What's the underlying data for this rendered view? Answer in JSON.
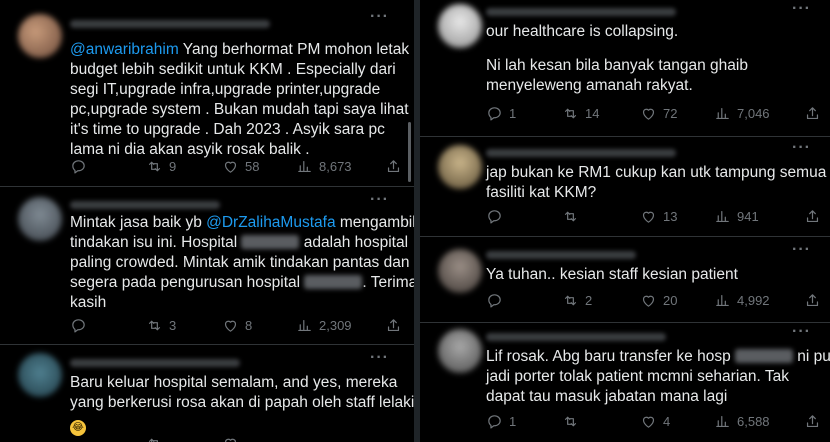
{
  "left": {
    "tweets": [
      {
        "lines": [
          {
            "mention": "@anwaribrahim",
            "rest": " Yang berhormat PM mohon letak"
          },
          {
            "text": "budget lebih sedikit untuk KKM . Especially dari"
          },
          {
            "text": "segi IT,upgrade infra,upgrade printer,upgrade"
          },
          {
            "text": "pc,upgrade system . Bukan mudah tapi saya lihat"
          },
          {
            "text": "it's time to upgrade . Dah 2023 . Asyik sara pc"
          },
          {
            "text": "lama ni dia akan asyik rosak balik ."
          }
        ],
        "retweets": "9",
        "likes": "58",
        "views": "8,673"
      },
      {
        "line1_pre": "Mintak jasa baik yb ",
        "line1_mention": "@DrZalihaMustafa",
        "line1_post": " mengambil",
        "line2_pre": "tindakan isu ini. Hospital ",
        "line2_post": " adalah hospital",
        "line3": "paling crowded. Mintak amik tindakan pantas dan",
        "line4_pre": "segera pada pengurusan hospital ",
        "line4_post": ". Terima",
        "line5": "kasih",
        "retweets": "3",
        "likes": "8",
        "views": "2,309"
      },
      {
        "line1": "Baru keluar hospital semalam, and yes, mereka",
        "line2": "yang berkerusi rosa akan di papah oleh staff lelaki"
      }
    ]
  },
  "right": {
    "tweets": [
      {
        "line1": "our healthcare is collapsing.",
        "line2": "Ni lah kesan bila banyak tangan ghaib",
        "line3": "menyeleweng amanah rakyat.",
        "replies": "1",
        "retweets": "14",
        "likes": "72",
        "views": "7,046"
      },
      {
        "line1": "jap bukan ke RM1 cukup kan utk tampung semua",
        "line2": "fasiliti kat KKM?",
        "likes": "13",
        "views": "941"
      },
      {
        "line1": "Ya tuhan.. kesian staff kesian patient",
        "retweets": "2",
        "likes": "20",
        "views": "4,992"
      },
      {
        "line1_pre": "Lif rosak. Abg baru transfer ke hosp ",
        "line1_post": " ni pun",
        "line2": "jadi porter tolak patient mcmni seharian. Tak",
        "line3": "dapat tau masuk jabatan mana lagi",
        "replies": "1",
        "likes": "4",
        "views": "6,588"
      }
    ]
  },
  "icons": {
    "reply": "reply-icon",
    "retweet": "retweet-icon",
    "like": "heart-icon",
    "views": "views-icon",
    "share": "share-icon",
    "more": "more-icon"
  },
  "more_glyph": "···",
  "emoji": "😂"
}
